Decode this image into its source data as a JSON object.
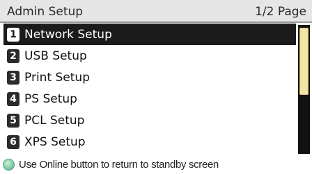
{
  "header": {
    "title": "Admin Setup",
    "page_indicator": "1/2 Page"
  },
  "menu": {
    "items": [
      {
        "number": "1",
        "label": "Network Setup",
        "selected": true
      },
      {
        "number": "2",
        "label": "USB Setup",
        "selected": false
      },
      {
        "number": "3",
        "label": "Print Setup",
        "selected": false
      },
      {
        "number": "4",
        "label": "PS Setup",
        "selected": false
      },
      {
        "number": "5",
        "label": "PCL Setup",
        "selected": false
      },
      {
        "number": "6",
        "label": "XPS Setup",
        "selected": false
      }
    ]
  },
  "scroll": {
    "position_fraction": 0.0,
    "visible_fraction": 0.5
  },
  "footer": {
    "icon": "online-led-icon",
    "hint": "Use Online button to return to standby screen"
  },
  "colors": {
    "header_bg": "#e6e6e6",
    "selected_bg": "#1b1b1b",
    "scroll_thumb": "#f3e4a0",
    "online_led": "#6fc49a"
  }
}
